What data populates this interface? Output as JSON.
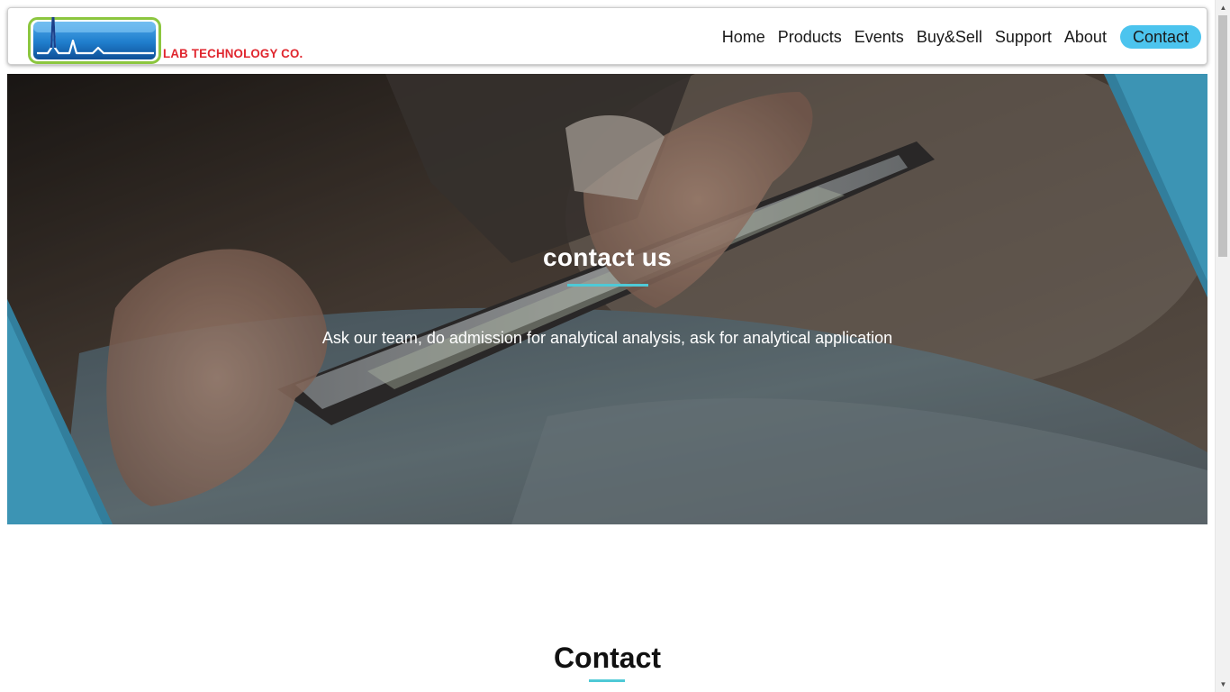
{
  "header": {
    "logo_text": "LAB TECHNOLOGY CO.",
    "nav": [
      {
        "label": "Home"
      },
      {
        "label": "Products"
      },
      {
        "label": "Events"
      },
      {
        "label": "Buy&Sell"
      },
      {
        "label": "Support"
      },
      {
        "label": "About"
      },
      {
        "label": "Contact",
        "active": true
      }
    ]
  },
  "hero": {
    "title": "contact us",
    "subtitle": "Ask our team, do admission for analytical analysis, ask for analytical application"
  },
  "section": {
    "title": "Contact"
  },
  "colors": {
    "accent": "#4cc4ee",
    "underline": "#4fc9d6",
    "logo_red": "#e0262e",
    "logo_blue": "#1a76c9",
    "logo_green": "#8cc63f"
  },
  "icons": {
    "scroll_up": "▲",
    "scroll_down": "▼"
  }
}
